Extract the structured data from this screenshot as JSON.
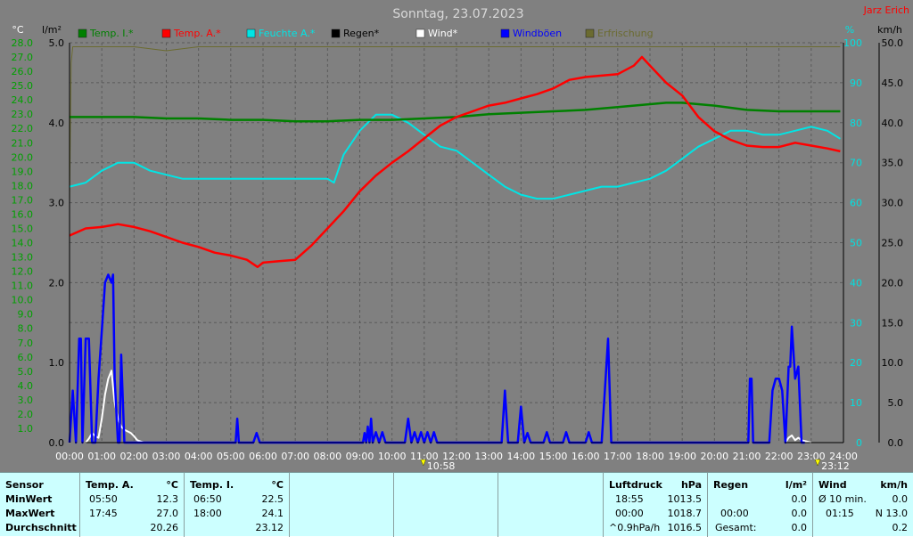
{
  "title": "Sonntag, 23.07.2023",
  "watermark": "Jarz Erich",
  "colors": {
    "background": "#808080",
    "grid": "#5a5a5a",
    "axis_text": "#ffffff",
    "left_axis_temp": "#00a000",
    "left_axis_rain": "#000000",
    "right_axis_pct": "#00e0e0",
    "right_axis_kmh": "#000000",
    "temp_inside": "#008000",
    "temp_outside": "#ff0000",
    "humidity_outside": "#00e5e5",
    "rain": "#000000",
    "wind": "#ffffff",
    "gusts": "#0000ff",
    "irradiance": "#6b6b30",
    "panel": "#ccffff",
    "watermark": "#ff0000"
  },
  "legend": [
    {
      "key": "temp_inside",
      "label": "Temp. I.*"
    },
    {
      "key": "temp_outside",
      "label": "Temp. A.*"
    },
    {
      "key": "humidity_outside",
      "label": "Feuchte A.*"
    },
    {
      "key": "rain",
      "label": "Regen*"
    },
    {
      "key": "wind",
      "label": "Wind*"
    },
    {
      "key": "gusts",
      "label": "Windböen"
    },
    {
      "key": "irradiance",
      "label": "Erfrischung"
    }
  ],
  "chart_data": {
    "type": "line",
    "grid": true,
    "legend_position": "top",
    "x_ticks": [
      "00:00",
      "01:00",
      "02:00",
      "03:00",
      "04:00",
      "05:00",
      "06:00",
      "07:00",
      "08:00",
      "09:00",
      "10:00",
      "11:00",
      "12:00",
      "13:00",
      "14:00",
      "15:00",
      "16:00",
      "17:00",
      "18:00",
      "19:00",
      "20:00",
      "21:00",
      "22:00",
      "23:00",
      "24:00"
    ],
    "x_range": [
      0,
      24
    ],
    "axes": {
      "temp": {
        "unit": "°C",
        "range": [
          0,
          28
        ],
        "ticks": [
          "0.0",
          "0.5",
          "1.0",
          "1.5",
          "2.0",
          "2.5",
          "3.0",
          "3.5",
          "4.0",
          "4.5",
          "5.0",
          "5.5",
          "6.0",
          "6.5",
          "7.0",
          "7.5",
          "8.0",
          "8.5",
          "9.0",
          "9.5",
          "10.0",
          "10.5",
          "11.0",
          "11.5",
          "12.0",
          "12.5",
          "13.0",
          "13.5",
          "14.0",
          "14.5",
          "15.0",
          "15.5",
          "16.0",
          "16.5",
          "17.0",
          "17.5",
          "18.0",
          "18.5",
          "19.0",
          "19.5",
          "20.0",
          "20.5",
          "21.0",
          "21.5",
          "22.0",
          "22.5",
          "23.0",
          "23.5",
          "24.0",
          "24.5",
          "25.0",
          "25.5",
          "26.0",
          "26.5",
          "27.0",
          "27.5",
          "28.0"
        ]
      },
      "rain": {
        "unit": "l/m²",
        "range": [
          0,
          5
        ],
        "ticks": [
          "0.0",
          "1.0",
          "2.0",
          "3.0",
          "4.0",
          "5.0"
        ]
      },
      "pct": {
        "unit": "%",
        "range": [
          0,
          100
        ],
        "ticks": [
          "0",
          "10",
          "20",
          "30",
          "40",
          "50",
          "60",
          "70",
          "80",
          "90",
          "100"
        ]
      },
      "kmh": {
        "unit": "km/h",
        "range": [
          0,
          50
        ],
        "ticks": [
          "0.0",
          "5.0",
          "10.0",
          "15.0",
          "20.0",
          "25.0",
          "30.0",
          "35.0",
          "40.0",
          "45.0",
          "50.0"
        ]
      }
    },
    "series": [
      {
        "name": "Temp. I.*",
        "key": "temp_inside",
        "axis": "temp",
        "x": [
          0,
          1,
          2,
          3,
          4,
          5,
          6,
          7,
          8,
          9,
          10,
          11,
          12,
          13,
          14,
          15,
          16,
          17,
          18,
          18.5,
          19,
          20,
          21,
          22,
          23,
          23.9
        ],
        "y": [
          22.8,
          22.8,
          22.8,
          22.7,
          22.7,
          22.6,
          22.6,
          22.5,
          22.5,
          22.6,
          22.6,
          22.7,
          22.8,
          23.0,
          23.1,
          23.2,
          23.3,
          23.5,
          23.7,
          23.8,
          23.8,
          23.6,
          23.3,
          23.2,
          23.2,
          23.2
        ]
      },
      {
        "name": "Temp. A.*",
        "key": "temp_outside",
        "axis": "temp",
        "x": [
          0,
          0.5,
          1,
          1.5,
          2,
          2.5,
          3,
          3.5,
          4,
          4.5,
          5,
          5.5,
          5.83,
          6,
          6.5,
          7,
          7.5,
          8,
          8.5,
          9,
          9.5,
          10,
          10.5,
          11,
          11.5,
          12,
          12.5,
          13,
          13.5,
          14,
          14.5,
          15,
          15.5,
          16,
          16.5,
          17,
          17.5,
          17.75,
          18,
          18.5,
          19,
          19.5,
          20,
          20.5,
          21,
          21.5,
          22,
          22.5,
          23,
          23.5,
          23.9
        ],
        "y": [
          14.5,
          15.0,
          15.1,
          15.3,
          15.1,
          14.8,
          14.4,
          14.0,
          13.7,
          13.3,
          13.1,
          12.8,
          12.3,
          12.6,
          12.7,
          12.8,
          13.8,
          15.0,
          16.2,
          17.6,
          18.7,
          19.6,
          20.4,
          21.3,
          22.2,
          22.8,
          23.2,
          23.6,
          23.8,
          24.1,
          24.4,
          24.8,
          25.4,
          25.6,
          25.7,
          25.8,
          26.4,
          27.0,
          26.4,
          25.2,
          24.3,
          22.8,
          21.8,
          21.2,
          20.8,
          20.7,
          20.7,
          21.0,
          20.8,
          20.6,
          20.4
        ]
      },
      {
        "name": "Feuchte A.*",
        "key": "humidity_outside",
        "axis": "pct",
        "x": [
          0,
          0.5,
          1,
          1.5,
          2,
          2.5,
          3,
          3.5,
          4,
          4.5,
          5,
          5.5,
          6,
          6.5,
          7,
          7.5,
          8,
          8.2,
          8.5,
          9,
          9.5,
          10,
          10.5,
          11,
          11.5,
          12,
          12.5,
          13,
          13.5,
          14,
          14.5,
          15,
          15.5,
          16,
          16.5,
          17,
          17.5,
          18,
          18.5,
          19,
          19.5,
          20,
          20.5,
          21,
          21.5,
          22,
          22.5,
          23,
          23.5,
          23.9
        ],
        "y": [
          64,
          65,
          68,
          70,
          70,
          68,
          67,
          66,
          66,
          66,
          66,
          66,
          66,
          66,
          66,
          66,
          66,
          65,
          72,
          78,
          82,
          82,
          80,
          77,
          74,
          73,
          70,
          67,
          64,
          62,
          61,
          61,
          62,
          63,
          64,
          64,
          65,
          66,
          68,
          71,
          74,
          76,
          78,
          78,
          77,
          77,
          78,
          79,
          78,
          76
        ]
      },
      {
        "name": "Windböen",
        "key": "gusts",
        "axis": "kmh",
        "x": [
          0,
          0.1,
          0.2,
          0.3,
          0.35,
          0.4,
          0.5,
          0.6,
          0.7,
          0.8,
          0.9,
          1.0,
          1.1,
          1.2,
          1.3,
          1.35,
          1.4,
          1.5,
          1.55,
          1.6,
          1.7,
          1.8,
          1.9,
          5.15,
          5.2,
          5.25,
          5.7,
          5.8,
          5.9,
          9.1,
          9.15,
          9.2,
          9.25,
          9.3,
          9.35,
          9.4,
          9.5,
          9.6,
          9.7,
          9.8,
          10.4,
          10.5,
          10.6,
          10.7,
          10.8,
          10.9,
          11.0,
          11.1,
          11.2,
          11.3,
          11.4,
          13.4,
          13.5,
          13.6,
          13.9,
          14.0,
          14.1,
          14.2,
          14.3,
          14.4,
          14.7,
          14.8,
          14.9,
          15.3,
          15.4,
          15.5,
          16.0,
          16.1,
          16.2,
          16.5,
          16.6,
          16.7,
          16.8,
          21.05,
          21.1,
          21.15,
          21.2,
          21.7,
          21.8,
          21.9,
          22.0,
          22.1,
          22.2,
          22.3,
          22.35,
          22.4,
          22.5,
          22.6,
          22.7,
          22.8
        ],
        "y": [
          0,
          6.5,
          0,
          13,
          13,
          0,
          13,
          13,
          0,
          0,
          8,
          14,
          20,
          21,
          20,
          21,
          8,
          0,
          0,
          11,
          0,
          0,
          0,
          0,
          3,
          0,
          0,
          1.2,
          0,
          0,
          1.2,
          0,
          2,
          0,
          3,
          0,
          1.3,
          0,
          1.3,
          0,
          0,
          3,
          0,
          1.3,
          0,
          1.3,
          0,
          1.3,
          0,
          1.3,
          0,
          0,
          6.5,
          0,
          0,
          4.5,
          0,
          1.2,
          0,
          0,
          0,
          1.3,
          0,
          0,
          1.3,
          0,
          0,
          1.3,
          0,
          0,
          6.5,
          13,
          0,
          0,
          8,
          8,
          0,
          0,
          6.5,
          8,
          8,
          6.5,
          0,
          9.5,
          9.5,
          14.5,
          8,
          9.5,
          0,
          0
        ]
      },
      {
        "name": "Wind*",
        "key": "wind",
        "axis": "kmh",
        "x": [
          0,
          0.5,
          0.6,
          0.7,
          0.8,
          0.9,
          1.0,
          1.1,
          1.2,
          1.3,
          1.4,
          1.5,
          1.6,
          1.7,
          1.8,
          1.9,
          2.0,
          2.1,
          2.3,
          22.2,
          22.3,
          22.4,
          22.5,
          22.6,
          22.7,
          22.8,
          23.0
        ],
        "y": [
          0,
          0,
          0.5,
          1.2,
          0.8,
          0.6,
          3,
          6,
          8,
          9,
          5,
          3,
          2,
          1.6,
          1.4,
          1.2,
          0.8,
          0.3,
          0,
          0,
          0.6,
          0.9,
          0.3,
          0.6,
          0.3,
          0.2,
          0
        ]
      },
      {
        "name": "Erfrischung",
        "key": "irradiance",
        "axis": "pct",
        "x": [
          0,
          0.05,
          0.1,
          0.15,
          1,
          2,
          3,
          4,
          5,
          6,
          7,
          8,
          9,
          10,
          11,
          12,
          13,
          14,
          15,
          16,
          17,
          18,
          19,
          20,
          21,
          22,
          23,
          23.9
        ],
        "y": [
          60,
          95,
          99,
          99,
          99,
          99,
          98,
          99,
          99,
          99,
          99,
          99,
          99,
          99,
          99,
          99,
          99,
          99,
          99,
          99,
          99,
          99,
          99,
          99,
          99,
          99,
          99,
          99
        ]
      }
    ]
  },
  "time_markers": [
    {
      "label": "10:58",
      "x": 10.97
    },
    {
      "label": "23:12",
      "x": 23.2
    }
  ],
  "panel": {
    "sensor": {
      "header": "Sensor",
      "min": "MinWert",
      "max": "MaxWert",
      "avg": "Durchschnitt"
    },
    "temp_a": {
      "header": "Temp. A.",
      "unit": "°C",
      "min_time": "05:50",
      "min_val": "12.3",
      "max_time": "17:45",
      "max_val": "27.0",
      "avg_val": "20.26"
    },
    "temp_i": {
      "header": "Temp. I.",
      "unit": "°C",
      "min_time": "06:50",
      "min_val": "22.5",
      "max_time": "18:00",
      "max_val": "24.1",
      "avg_val": "23.12"
    },
    "pressure": {
      "header": "Luftdruck",
      "unit": "hPa",
      "min_time": "18:55",
      "min_val": "1013.5",
      "max_time": "00:00",
      "max_val": "1018.7",
      "trend": "^0.9hPa/h",
      "avg_val": "1016.5"
    },
    "rain": {
      "header": "Regen",
      "unit": "l/m²",
      "max_time": "00:00",
      "max_val": "0.0",
      "total_label": "Gesamt:",
      "total_val": "0.0",
      "min_val": "0.0"
    },
    "wind": {
      "header": "Wind",
      "unit": "km/h",
      "min_label": "Ø 10 min.",
      "min_val": "0.0",
      "max_time": "01:15",
      "max_val": "N 13.0",
      "avg_val": "0.2"
    }
  }
}
